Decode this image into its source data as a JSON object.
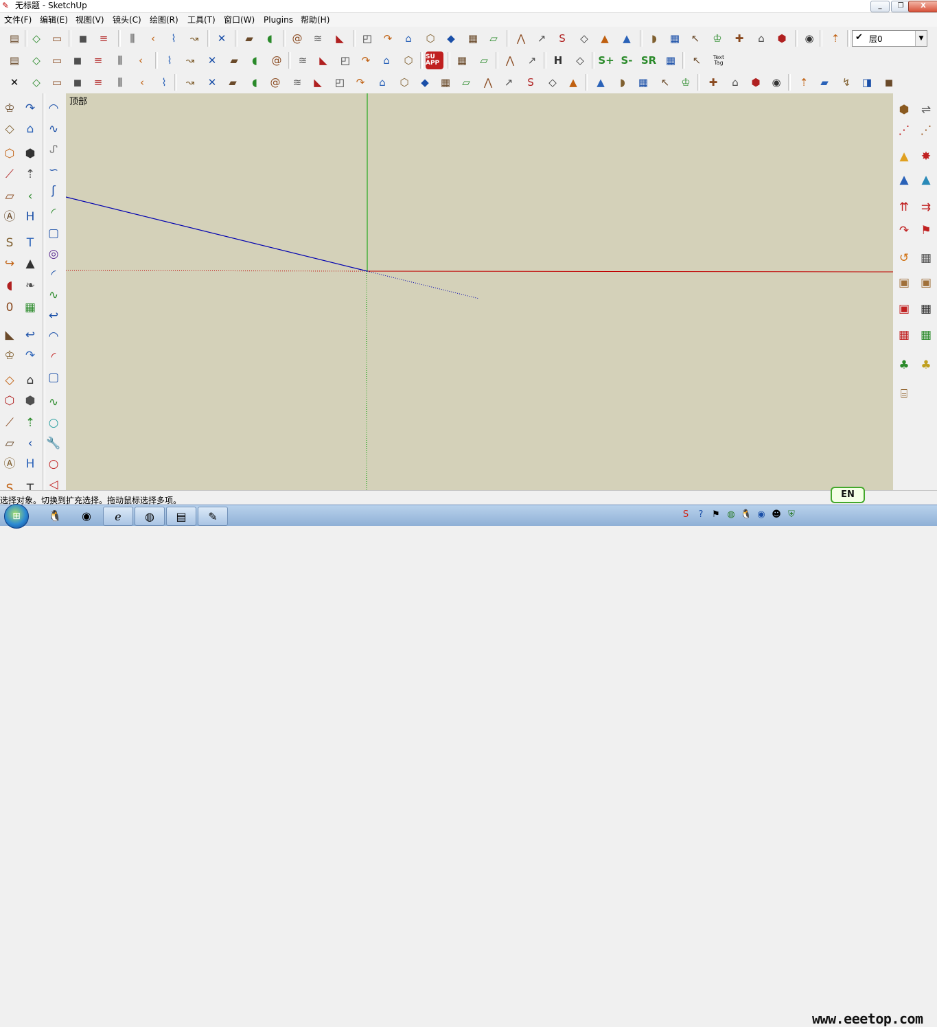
{
  "window": {
    "title": "无标题 - SketchUp",
    "min_label": "_",
    "restore_label": "❐",
    "close_label": "X"
  },
  "menu": [
    "文件(F)",
    "编辑(E)",
    "视图(V)",
    "镜头(C)",
    "绘图(R)",
    "工具(T)",
    "窗口(W)",
    "Plugins",
    "帮助(H)"
  ],
  "toolbar": {
    "layer": {
      "checked": "✔",
      "value": "层0",
      "arrow": "▼"
    },
    "ruby_label": "SU APP",
    "smooth_labels": {
      "h": "H",
      "s_plus": "S+",
      "s_minus": "S-",
      "sr": "SR"
    },
    "text_tag": "Text Tag",
    "shape_tools_row3_start": "✕"
  },
  "icons": {
    "row1": [
      "new-file-icon",
      "open-file-icon",
      "save-icon",
      "user-add-icon",
      "user-remove-icon",
      "print-icon",
      "print-preview-icon",
      "undo-icon",
      "redo-icon",
      "delete-icon",
      "add-location-icon",
      "remove-location-icon",
      "component-window-icon",
      "material-window-icon",
      "model-info-icon",
      "house-iso-icon",
      "house-front-icon",
      "house-right-icon",
      "house-back-icon",
      "house-left-icon",
      "house-top-icon",
      "house-bottom-icon",
      "xray-icon",
      "wireframe-icon",
      "hidden-line-icon",
      "shaded-icon",
      "shaded-texture-icon",
      "monochrome-icon",
      "style-box-icon",
      "style-color-icon",
      "style-dark-icon",
      "style-info-icon",
      "paint-bucket-icon",
      "axes-icon",
      "layers-info-icon",
      "3d-warehouse-icon",
      "section-plane-icon"
    ],
    "row2": [
      "weld-icon",
      "extrude-icon",
      "frame-icon",
      "grid-icon",
      "louver-icon",
      "pipe-icon",
      "plate-icon",
      "check-icon",
      "rect-fill-icon",
      "cube-red-icon",
      "arc-fill-icon",
      "chevron-icon",
      "arrow-red-icon",
      "scale-icon",
      "mirror-icon",
      "bend-icon",
      "3d-text-icon",
      "rb-text-icon",
      "tube-icon",
      "su-app-icon",
      "follow-arrow-icon",
      "h-arrow-icon",
      "split-blue-icon",
      "split-green-icon",
      "h-tool-icon",
      "curve-tool-icon",
      "s-plus-icon",
      "s-minus-icon",
      "sr-icon",
      "cube-green-icon",
      "a-text-icon",
      "text-tag-icon"
    ],
    "row3": [
      "close-x-icon",
      "grid-plane-icon",
      "diamond-icon",
      "loop-icon",
      "hook-icon",
      "hook2-icon",
      "spring-icon",
      "panel-icon",
      "pyramid-icon",
      "cone-icon",
      "sphere-icon",
      "box-icon",
      "torus-icon",
      "tetra-icon",
      "dome-icon",
      "prism-icon",
      "pyramid2-icon",
      "dodeca-icon",
      "ico-icon",
      "gem-icon",
      "drop-icon",
      "helix-icon",
      "swirl-icon",
      "leaf-icon",
      "egg-icon",
      "bowl-icon",
      "lid-icon",
      "arc-green-icon",
      "mesh-icon",
      "surface-green-icon",
      "surface-yellow-icon",
      "ribbon-icon",
      "ramp1-icon",
      "ramp2-icon",
      "ramp3-icon",
      "ramp4-icon",
      "stick-icon",
      "bracket-icon",
      "stairs-icon",
      "hook3-icon",
      "frame-box-icon"
    ],
    "left": [
      "select-icon",
      "component-icon",
      "paint-bucket-icon",
      "eraser-icon",
      "rectangle-icon",
      "pencil-icon",
      "circle-icon",
      "arc-icon",
      "polygon-icon",
      "freehand-icon",
      "move-icon",
      "push-pull-icon",
      "rotate-icon",
      "follow-me-icon",
      "scale-icon",
      "offset-icon",
      "tape-measure-icon",
      "dimension-icon",
      "protractor-icon",
      "text-icon",
      "axes-icon",
      "3d-text-icon",
      "orbit-icon",
      "pan-icon",
      "zoom-icon",
      "zoom-window-icon",
      "zoom-extents-icon",
      "previous-view-icon",
      "position-camera-icon",
      "look-around-icon",
      "walk-icon",
      "section-icon",
      "sandbox-icon",
      "cube-icon",
      "bottom-a-icon",
      "bottom-b-icon"
    ],
    "curves": [
      "bezier-icon",
      "polyline-icon",
      "spline-icon",
      "catmull-icon",
      "curvature-icon",
      "arc-green-icon",
      "rounded-rect-icon",
      "spiral-icon",
      "arc-blue-icon",
      "zigzag-icon",
      "hook-icon",
      "arc2-icon",
      "arc-red-icon",
      "rounded-shape-icon",
      "polyline2-icon",
      "polygon-dot-icon",
      "wrench-icon",
      "circle-red-icon",
      "wedge-icon"
    ],
    "right": [
      "box-tool-icon",
      "pipe-tool-icon",
      "dots-red-icon",
      "dots-path-icon",
      "triangle-icon",
      "star-icon",
      "mountain-blue-icon",
      "mountain-hash-icon",
      "move-up-icon",
      "move-side-icon",
      "curve-flip-icon",
      "flag-icon",
      "rotate-orange-icon",
      "cube-grid-icon",
      "box-tan-icon",
      "box-tan2-icon",
      "box-red-icon",
      "cube-wire-icon",
      "cube-wire2-icon",
      "cube-wire3-icon",
      "tree-green-icon",
      "tree-tools-icon",
      "fence-icon"
    ]
  },
  "canvas": {
    "view_label": "顶部",
    "background": "#d4d1b9"
  },
  "axes_colors": {
    "red": "#c00000",
    "green": "#00a000",
    "blue": "#0000b0"
  },
  "status": {
    "text": "选择对象。切换到扩充选择。拖动鼠标选择多项。",
    "ime": "EN"
  },
  "taskbar": {
    "watermark": "www.eeetop.com"
  }
}
